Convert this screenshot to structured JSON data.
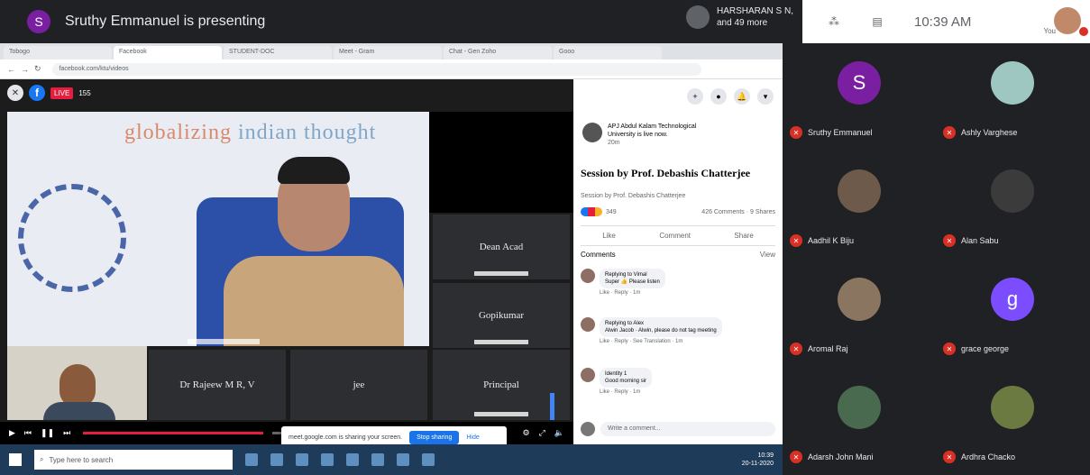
{
  "meeting": {
    "presenter_initial": "S",
    "presenting_text": "Sruthy Emmanuel is presenting",
    "others_line1": "HARSHARAN S N,",
    "others_line2": "and 49 more",
    "time": "10:39 AM",
    "you_label": "You"
  },
  "browser": {
    "tabs": [
      "Tobogo",
      "Facebook",
      "STUDENT-DOC",
      "Meet - Gram",
      "Chat - Gen Zoho",
      "Gooo"
    ],
    "address": "facebook.com/ktu/videos"
  },
  "stream": {
    "live_label": "LIVE",
    "viewers": "155",
    "banner_word1": "globalizing",
    "banner_word2": "indian",
    "banner_word3": "thought",
    "tiles": [
      "Dean Acad",
      "Gopikumar",
      "Dr Rajeew M R, V",
      "jee",
      "Principal"
    ]
  },
  "share": {
    "text": "meet.google.com is sharing your screen.",
    "stop_label": "Stop sharing",
    "hide_label": "Hide"
  },
  "fb_post": {
    "page_name": "APJ Abdul Kalam Technological University is live now.",
    "time": "20m",
    "title": "Session by Prof. Debashis Chatterjee",
    "subtitle": "Session by Prof. Debashis Chatterjee",
    "reaction_count": "349",
    "comments_shares": "426 Comments · 9 Shares",
    "like": "Like",
    "comment": "Comment",
    "share": "Share",
    "comments_label": "Comments",
    "view_label": "View",
    "comments": [
      {
        "author": "Replying to Vimal",
        "text": "Super 👍 Please listen",
        "meta": "Like · Reply · 1m"
      },
      {
        "author": "Replying to Alex",
        "text": "Alwin Jacob · Alwin, please do not tag meeting",
        "meta": "Like · Reply · See Translation · 1m"
      },
      {
        "author": "Identity 1",
        "text": "Good morning sir",
        "meta": "Like · Reply · 1m"
      }
    ],
    "write_placeholder": "Write a comment..."
  },
  "taskbar": {
    "search_placeholder": "Type here to search",
    "clock": "10:39",
    "date": "20-11-2020"
  },
  "participants": [
    {
      "name": "Sruthy Emmanuel",
      "initial": "S",
      "color": "#7b1fa2"
    },
    {
      "name": "Ashly Varghese",
      "initial": "",
      "color": "#9ec7c2"
    },
    {
      "name": "Aadhil K Biju",
      "initial": "",
      "color": "#6d5a4a"
    },
    {
      "name": "Alan Sabu",
      "initial": "",
      "color": "#3b3b3b"
    },
    {
      "name": "Aromal Raj",
      "initial": "",
      "color": "#8a7560"
    },
    {
      "name": "grace george",
      "initial": "g",
      "color": "#7c4dff"
    },
    {
      "name": "Adarsh John Mani",
      "initial": "",
      "color": "#4a6a50"
    },
    {
      "name": "Ardhra Chacko",
      "initial": "",
      "color": "#6a7a40"
    }
  ]
}
